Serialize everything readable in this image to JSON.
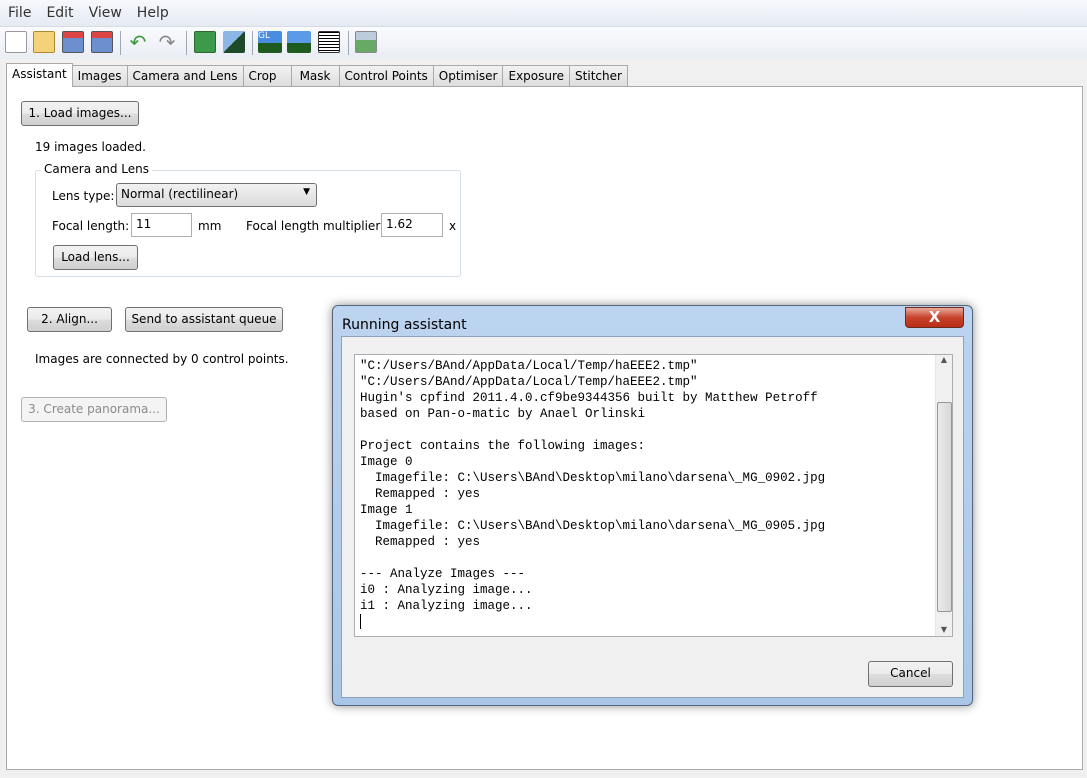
{
  "menu": [
    "File",
    "Edit",
    "View",
    "Help"
  ],
  "toolbar_icons": [
    "new-project-icon",
    "open-project-icon",
    "save-icon",
    "save-as-icon",
    "undo-icon",
    "redo-icon",
    "add-images-icon",
    "align-icon",
    "fast-preview-icon",
    "preview-icon",
    "project-properties-icon",
    "panorama-icon"
  ],
  "tabs": [
    "Assistant",
    "Images",
    "Camera and Lens",
    "Crop",
    "Mask",
    "Control Points",
    "Optimiser",
    "Exposure",
    "Stitcher"
  ],
  "assistant": {
    "load_images": "1. Load images...",
    "images_loaded": "19 images loaded.",
    "group_title": "Camera and Lens",
    "lens_type_label": "Lens type:",
    "lens_type_value": "Normal (rectilinear)",
    "focal_length_label": "Focal length:",
    "focal_length_value": "11",
    "mm": "mm",
    "multiplier_label": "Focal length multiplier:",
    "multiplier_value": "1.62",
    "x": "x",
    "load_lens": "Load lens...",
    "align": "2. Align...",
    "send_queue": "Send to assistant queue",
    "connected": "Images are connected by 0 control points.",
    "create_panorama": "3. Create panorama..."
  },
  "dialog": {
    "title": "Running assistant",
    "close": "X",
    "cancel": "Cancel",
    "log": [
      "\"C:/Users/BAnd/AppData/Local/Temp/haEEE2.tmp\"",
      "\"C:/Users/BAnd/AppData/Local/Temp/haEEE2.tmp\"",
      "Hugin's cpfind 2011.4.0.cf9be9344356 built by Matthew Petroff",
      "based on Pan-o-matic by Anael Orlinski",
      "",
      "Project contains the following images:",
      "Image 0",
      "  Imagefile: C:\\Users\\BAnd\\Desktop\\milano\\darsena\\_MG_0902.jpg",
      "  Remapped : yes",
      "Image 1",
      "  Imagefile: C:\\Users\\BAnd\\Desktop\\milano\\darsena\\_MG_0905.jpg",
      "  Remapped : yes",
      "",
      "--- Analyze Images ---",
      "i0 : Analyzing image...",
      "i1 : Analyzing image...",
      ""
    ]
  }
}
